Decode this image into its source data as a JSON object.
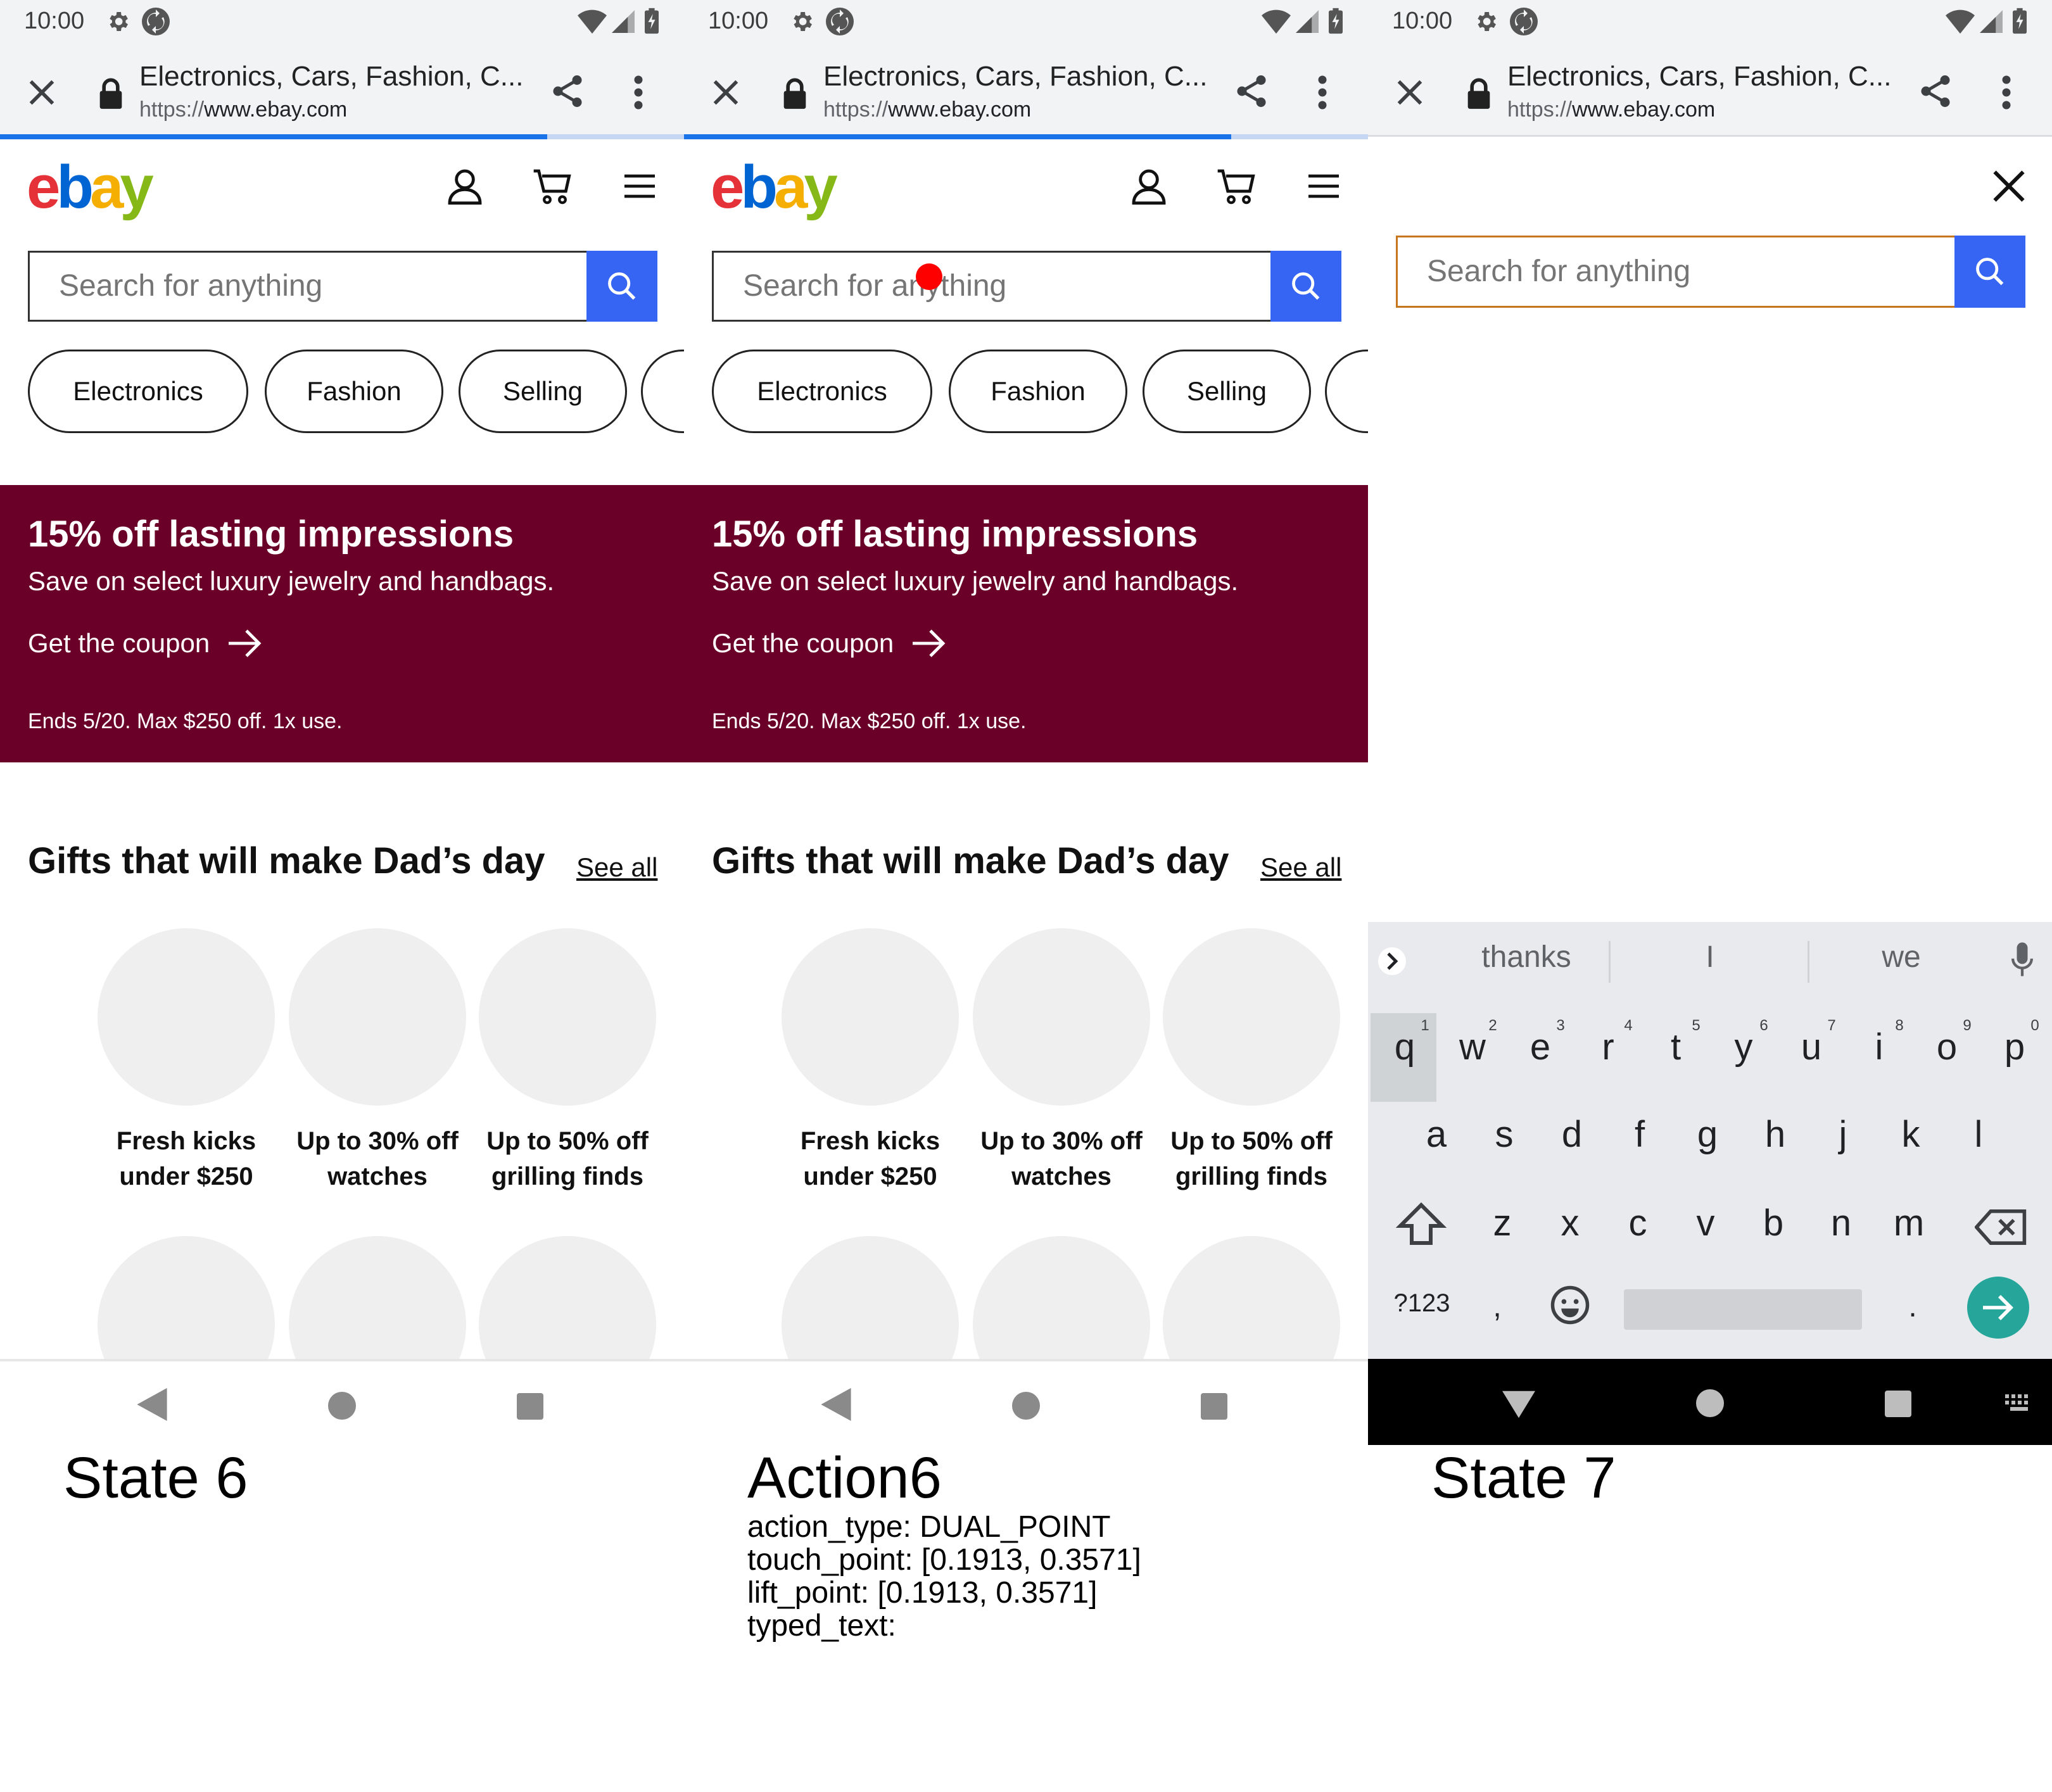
{
  "status_bar": {
    "time": "10:00"
  },
  "browser": {
    "title": "Electronics, Cars, Fashion, C...",
    "url_proto": "https://",
    "url_host": "www.ebay.com"
  },
  "ebay": {
    "logo": {
      "e": "e",
      "b": "b",
      "a": "a",
      "y": "y"
    },
    "search_placeholder": "Search for anything",
    "pills": [
      "Electronics",
      "Fashion",
      "Selling"
    ],
    "banner": {
      "title": "15% off lasting impressions",
      "subtitle": "Save on select luxury jewelry and handbags.",
      "cta": "Get the coupon",
      "fine_print": "Ends 5/20. Max $250 off. 1x use.",
      "color": "#6a0028"
    },
    "section": {
      "title": "Gifts that will make Dad’s day",
      "see_all": "See all",
      "items": [
        {
          "line1": "Fresh kicks",
          "line2": "under $250"
        },
        {
          "line1": "Up to 30% off",
          "line2": "watches"
        },
        {
          "line1": "Up to 50% off",
          "line2": "grilling finds"
        }
      ]
    }
  },
  "labels": {
    "state6": "State 6",
    "action6": "Action6",
    "state7": "State 7"
  },
  "action": {
    "action_type": "action_type: DUAL_POINT",
    "touch_point": "touch_point: [0.1913, 0.3571]",
    "lift_point": "lift_point: [0.1913, 0.3571]",
    "typed_text": "typed_text:"
  },
  "keyboard": {
    "suggestions": [
      "thanks",
      "I",
      "we"
    ],
    "row1": [
      "q",
      "w",
      "e",
      "r",
      "t",
      "y",
      "u",
      "i",
      "o",
      "p"
    ],
    "row1_nums": [
      "1",
      "2",
      "3",
      "4",
      "5",
      "6",
      "7",
      "8",
      "9",
      "0"
    ],
    "row2": [
      "a",
      "s",
      "d",
      "f",
      "g",
      "h",
      "j",
      "k",
      "l"
    ],
    "row3": [
      "z",
      "x",
      "c",
      "v",
      "b",
      "n",
      "m"
    ],
    "symbols_key": "?123",
    "comma": ",",
    "period": "."
  },
  "colors": {
    "accent_blue": "#3665f3",
    "tap_marker": "#ff0000",
    "enter_key": "#26a69a"
  }
}
